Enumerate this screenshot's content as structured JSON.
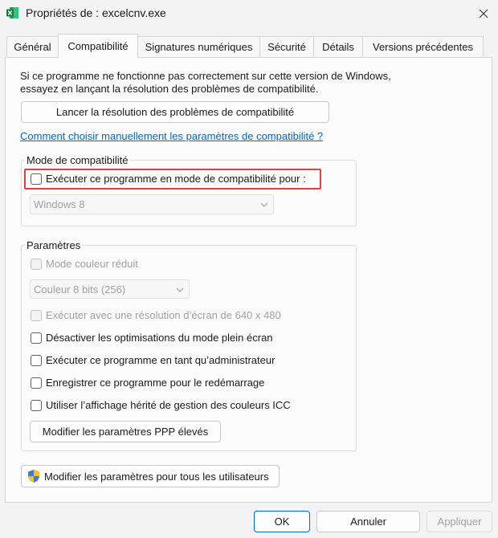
{
  "window": {
    "title": "Propriétés de : excelcnv.exe"
  },
  "tabs": [
    {
      "label": "Général"
    },
    {
      "label": "Compatibilité"
    },
    {
      "label": "Signatures numériques"
    },
    {
      "label": "Sécurité"
    },
    {
      "label": "Détails"
    },
    {
      "label": "Versions précédentes"
    }
  ],
  "intro": {
    "line1": "Si ce programme ne fonctionne pas correctement sur cette version de Windows,",
    "line2": "essayez en lançant la résolution des problèmes de compatibilité."
  },
  "troubleshoot_button": "Lancer la résolution des problèmes de compatibilité",
  "manual_link": "Comment choisir manuellement les paramètres de compatibilité ?",
  "compat_mode": {
    "group_label": "Mode de compatibilité",
    "checkbox_label": "Exécuter ce programme en mode de compatibilité pour :",
    "checked": false,
    "os_select_value": "Windows 8"
  },
  "settings": {
    "group_label": "Paramètres",
    "reduced_color": {
      "label": "Mode couleur réduit",
      "checked": false,
      "enabled": false
    },
    "color_select_value": "Couleur 8 bits (256)",
    "res_640": {
      "label": "Exécuter avec une résolution d’écran de 640 x 480",
      "checked": false,
      "enabled": false
    },
    "disable_fullscreen": {
      "label": "Désactiver les optimisations du mode plein écran",
      "checked": false
    },
    "run_as_admin": {
      "label": "Exécuter ce programme en tant qu’administrateur",
      "checked": false
    },
    "register_restart": {
      "label": "Enregistrer ce programme pour le redémarrage",
      "checked": false
    },
    "legacy_icc": {
      "label": "Utiliser l’affichage hérité de gestion des couleurs ICC",
      "checked": false
    },
    "dpi_button": "Modifier les paramètres PPP élevés"
  },
  "all_users_button": "Modifier les paramètres pour tous les utilisateurs",
  "footer": {
    "ok": "OK",
    "cancel": "Annuler",
    "apply": "Appliquer"
  },
  "colors": {
    "accent": "#0067c0",
    "highlight": "#e2403f",
    "excel_green": "#107c41"
  }
}
